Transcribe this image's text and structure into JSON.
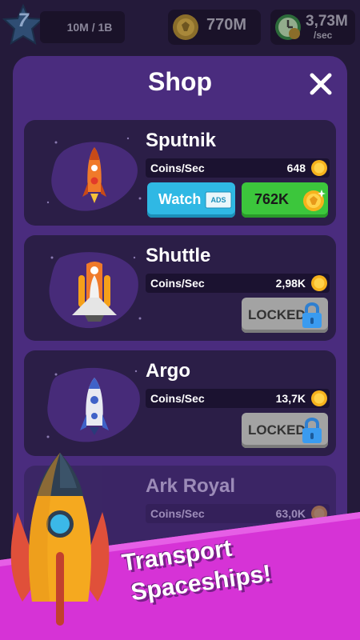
{
  "hud": {
    "level": "7",
    "progress": "10M / 1B",
    "coins": "770M",
    "rate_value": "3,73M",
    "rate_unit": "/sec"
  },
  "shop": {
    "title": "Shop",
    "items": [
      {
        "name": "Sputnik",
        "stat_label": "Coins/Sec",
        "stat_value": "648",
        "watch_label": "Watch",
        "ads_label": "ADS",
        "price": "762K",
        "state": "buy"
      },
      {
        "name": "Shuttle",
        "stat_label": "Coins/Sec",
        "stat_value": "2,98K",
        "locked_label": "LOCKED",
        "state": "locked"
      },
      {
        "name": "Argo",
        "stat_label": "Coins/Sec",
        "stat_value": "13,7K",
        "locked_label": "LOCKED",
        "state": "locked"
      },
      {
        "name": "Ark Royal",
        "stat_label": "Coins/Sec",
        "stat_value": "63,0K",
        "state": "locked"
      }
    ]
  },
  "banner": {
    "line1": "Transport",
    "line2": "Spaceships!"
  },
  "colors": {
    "background": "#241a3a",
    "panel": "#4a2c7e",
    "card": "#2b1e47",
    "watch": "#2fb8e4",
    "buy": "#3cc63c",
    "locked": "#a3a3a3",
    "banner": "#d633d6"
  }
}
